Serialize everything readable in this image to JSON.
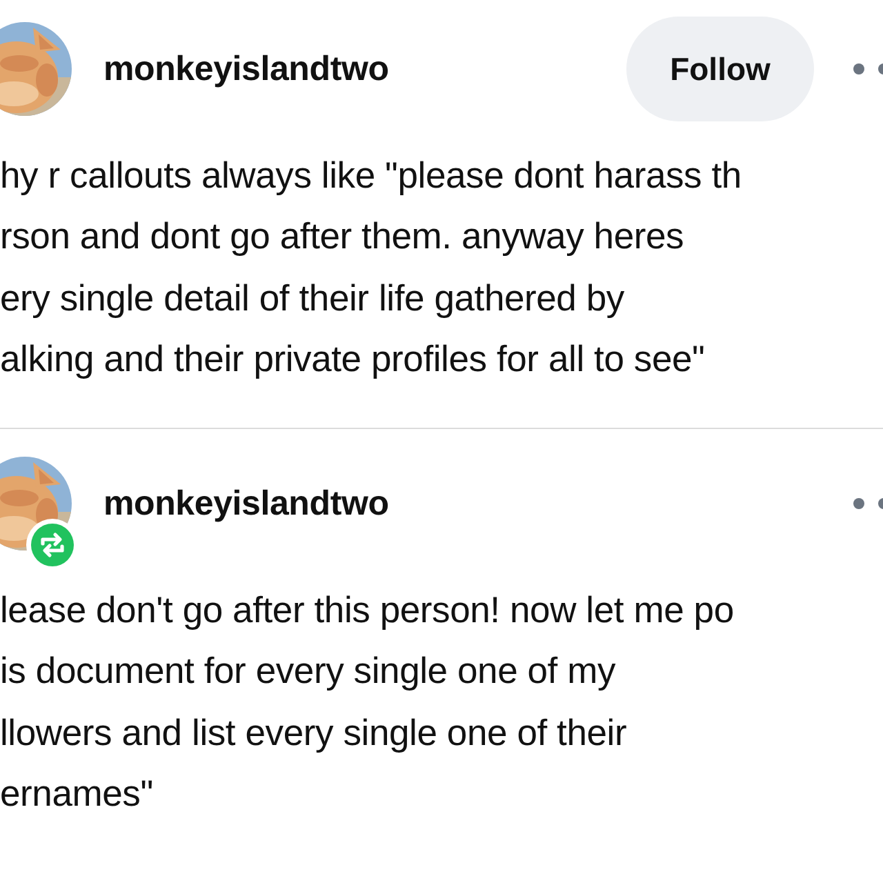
{
  "posts": [
    {
      "author": "monkeyislandtwo",
      "follow_button": "Follow",
      "reblogged": false,
      "lines": [
        "hy r callouts always like \"please dont harass th",
        "rson and dont go after them. anyway heres",
        "ery single detail of their life gathered by",
        "alking and their private profiles for all to see\""
      ]
    },
    {
      "author": "monkeyislandtwo",
      "reblogged": true,
      "lines": [
        "lease don't go after this person! now let me po",
        "is document for every single one of my",
        "llowers and list every single one of their",
        "ernames\""
      ]
    }
  ]
}
